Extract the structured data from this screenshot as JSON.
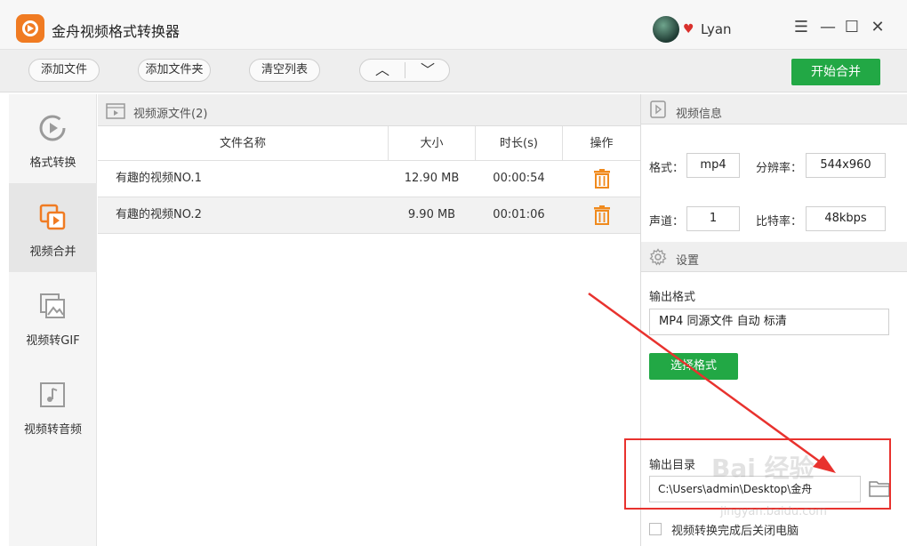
{
  "app": {
    "title": "金舟视频格式转换器",
    "user": "Lyan"
  },
  "window_controls": {
    "menu": "☰",
    "minimize": "—",
    "maximize": "☐",
    "close": "✕"
  },
  "toolbar": {
    "add_file": "添加文件",
    "add_folder": "添加文件夹",
    "clear_list": "清空列表",
    "move_up": "︿",
    "move_down": "﹀",
    "start_merge": "开始合并"
  },
  "sidebar": {
    "items": [
      {
        "label": "格式转换",
        "icon": "play-circle-icon"
      },
      {
        "label": "视频合并",
        "icon": "merge-video-icon"
      },
      {
        "label": "视频转GIF",
        "icon": "image-icon"
      },
      {
        "label": "视频转音频",
        "icon": "music-icon"
      }
    ],
    "active_index": 1
  },
  "file_list": {
    "title": "视频源文件(2)",
    "columns": [
      "文件名称",
      "大小",
      "时长(s)",
      "操作"
    ],
    "rows": [
      {
        "name": "有趣的视频NO.1",
        "size": "12.90 MB",
        "duration": "00:00:54"
      },
      {
        "name": "有趣的视频NO.2",
        "size": "9.90 MB",
        "duration": "00:01:06"
      }
    ]
  },
  "video_info": {
    "title": "视频信息",
    "format_label": "格式：",
    "format_value": "mp4",
    "resolution_label": "分辨率：",
    "resolution_value": "544x960",
    "channel_label": "声道：",
    "channel_value": "1",
    "bitrate_label": "比特率：",
    "bitrate_value": "48kbps"
  },
  "settings": {
    "title": "设置",
    "output_format_label": "输出格式",
    "output_format_value": "MP4 同源文件 自动 标清",
    "select_format_button": "选择格式",
    "output_dir_label": "输出目录",
    "output_dir_value": "C:\\Users\\admin\\Desktop\\金舟",
    "shutdown_label": "视频转换完成后关闭电脑"
  },
  "overlay": {
    "watermark": "Bai 经验",
    "watermark_url": "jingyan.baidu.com"
  },
  "colors": {
    "accent_green": "#22a845",
    "accent_orange": "#f08a1d",
    "annotation_red": "#e8322e"
  }
}
